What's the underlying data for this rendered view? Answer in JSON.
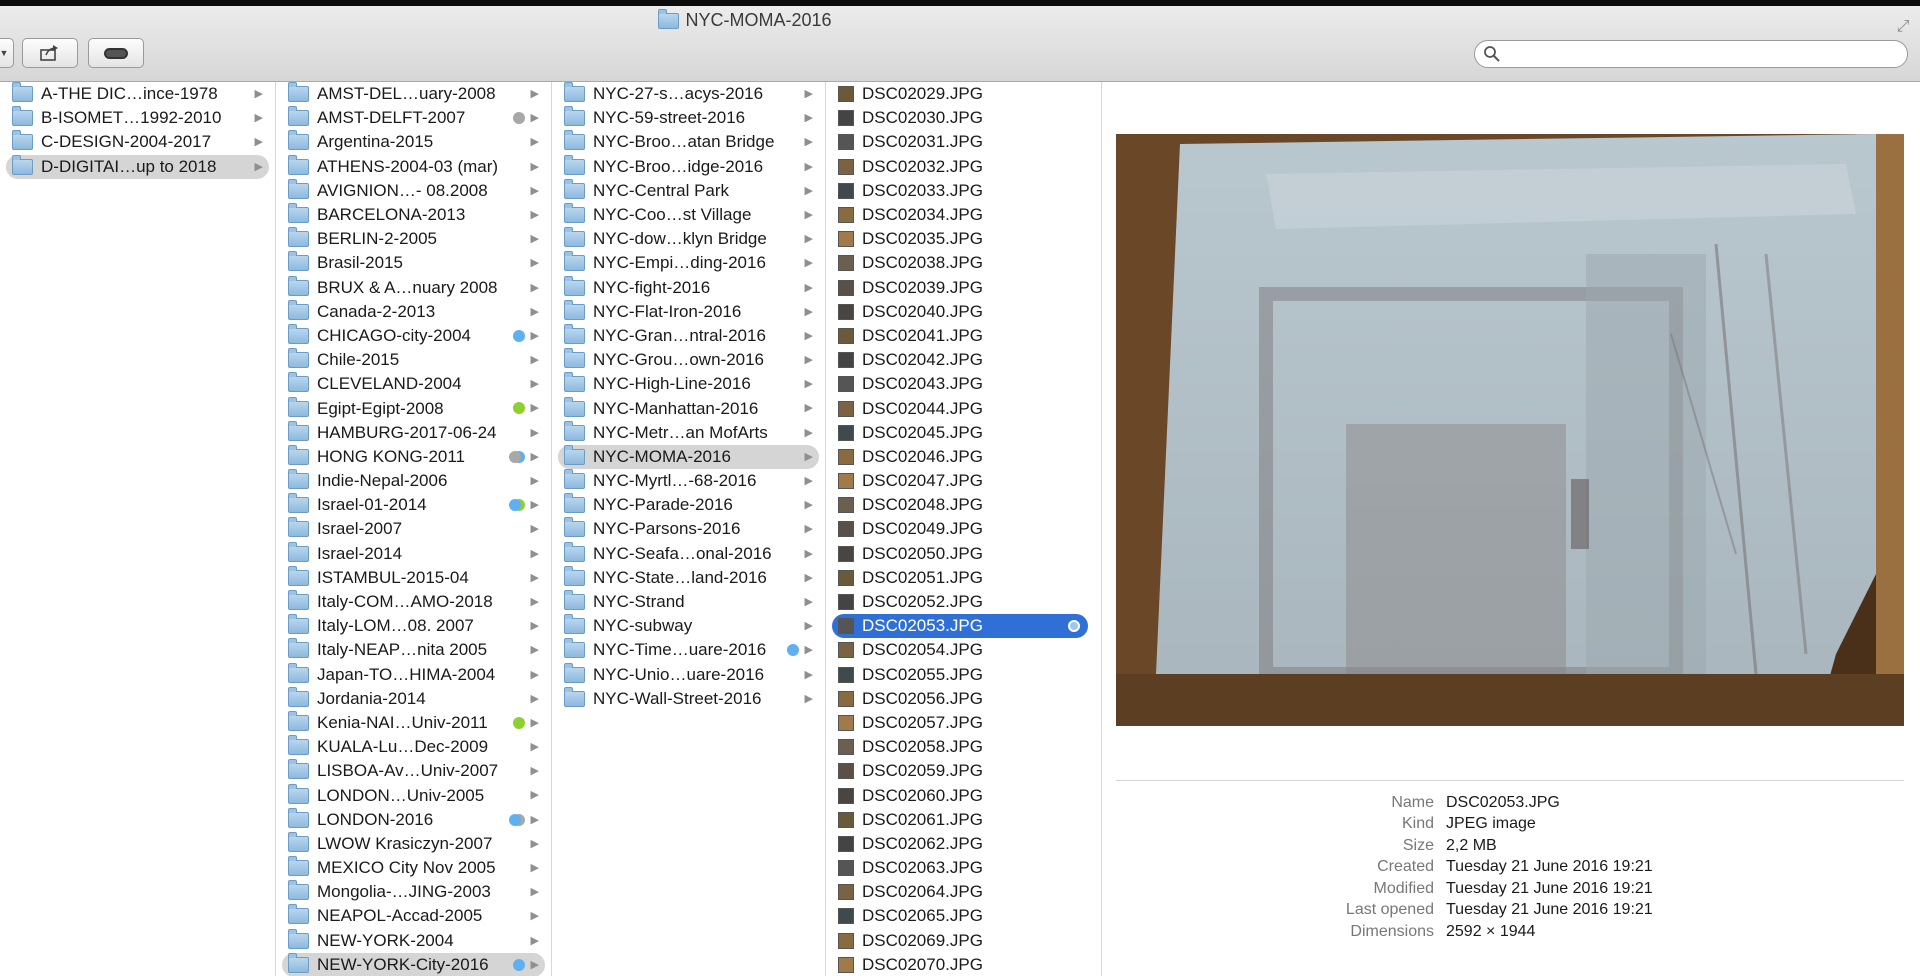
{
  "window": {
    "title": "NYC-MOMA-2016"
  },
  "search": {
    "placeholder": ""
  },
  "columns": {
    "c1": [
      {
        "label": "A-THE DIC…ince-1978"
      },
      {
        "label": "B-ISOMET…1992-2010"
      },
      {
        "label": "C-DESIGN-2004-2017"
      },
      {
        "label": "D-DIGITAI…up to 2018",
        "selected": true
      }
    ],
    "c2": [
      {
        "label": "AMST-DEL…uary-2008"
      },
      {
        "label": "AMST-DELFT-2007",
        "tags": [
          "#a8a8a8"
        ]
      },
      {
        "label": "Argentina-2015"
      },
      {
        "label": "ATHENS-2004-03 (mar)"
      },
      {
        "label": "AVIGNION…- 08.2008"
      },
      {
        "label": "BARCELONA-2013"
      },
      {
        "label": "BERLIN-2-2005"
      },
      {
        "label": "Brasil-2015"
      },
      {
        "label": "BRUX & A…nuary 2008"
      },
      {
        "label": "Canada-2-2013"
      },
      {
        "label": "CHICAGO-city-2004",
        "tags": [
          "#5fb0f0"
        ]
      },
      {
        "label": "Chile-2015"
      },
      {
        "label": "CLEVELAND-2004"
      },
      {
        "label": "Egipt-Egipt-2008",
        "tags": [
          "#8fd030"
        ]
      },
      {
        "label": "HAMBURG-2017-06-24"
      },
      {
        "label": "HONG KONG-2011",
        "tags": [
          "#5fb0f0",
          "#a8a8a8"
        ]
      },
      {
        "label": "Indie-Nepal-2006"
      },
      {
        "label": "Israel-01-2014",
        "tags": [
          "#8fd030",
          "#5fb0f0"
        ]
      },
      {
        "label": "Israel-2007"
      },
      {
        "label": "Israel-2014"
      },
      {
        "label": "ISTAMBUL-2015-04"
      },
      {
        "label": "Italy-COM…AMO-2018"
      },
      {
        "label": "Italy-LOM…08. 2007"
      },
      {
        "label": "Italy-NEAP…nita 2005"
      },
      {
        "label": "Japan-TO…HIMA-2004"
      },
      {
        "label": "Jordania-2014"
      },
      {
        "label": "Kenia-NAI…Univ-2011",
        "tags": [
          "#8fd030"
        ]
      },
      {
        "label": "KUALA-Lu…Dec-2009"
      },
      {
        "label": "LISBOA-Av…Univ-2007"
      },
      {
        "label": "LONDON…Univ-2005"
      },
      {
        "label": "LONDON-2016",
        "tags": [
          "#a8a8a8",
          "#5fb0f0"
        ]
      },
      {
        "label": "LWOW Krasiczyn-2007"
      },
      {
        "label": "MEXICO City Nov 2005"
      },
      {
        "label": "Mongolia-…JING-2003"
      },
      {
        "label": "NEAPOL-Accad-2005"
      },
      {
        "label": "NEW-YORK-2004"
      },
      {
        "label": "NEW-YORK-City-2016",
        "tags": [
          "#5fb0f0"
        ],
        "selected": true
      }
    ],
    "c3": [
      {
        "label": "NYC-27-s…acys-2016"
      },
      {
        "label": "NYC-59-street-2016"
      },
      {
        "label": "NYC-Broo…atan Bridge"
      },
      {
        "label": "NYC-Broo…idge-2016"
      },
      {
        "label": "NYC-Central Park"
      },
      {
        "label": "NYC-Coo…st Village"
      },
      {
        "label": "NYC-dow…klyn Bridge"
      },
      {
        "label": "NYC-Empi…ding-2016"
      },
      {
        "label": "NYC-fight-2016"
      },
      {
        "label": "NYC-Flat-Iron-2016"
      },
      {
        "label": "NYC-Gran…ntral-2016"
      },
      {
        "label": "NYC-Grou…own-2016"
      },
      {
        "label": "NYC-High-Line-2016"
      },
      {
        "label": "NYC-Manhattan-2016"
      },
      {
        "label": "NYC-Metr…an MofArts"
      },
      {
        "label": "NYC-MOMA-2016",
        "selected": true
      },
      {
        "label": "NYC-Myrtl…-68-2016"
      },
      {
        "label": "NYC-Parade-2016"
      },
      {
        "label": "NYC-Parsons-2016"
      },
      {
        "label": "NYC-Seafa…onal-2016"
      },
      {
        "label": "NYC-State…land-2016"
      },
      {
        "label": "NYC-Strand"
      },
      {
        "label": "NYC-subway"
      },
      {
        "label": "NYC-Time…uare-2016",
        "tags": [
          "#5fb0f0"
        ]
      },
      {
        "label": "NYC-Unio…uare-2016"
      },
      {
        "label": "NYC-Wall-Street-2016"
      }
    ],
    "c4": [
      "DSC02029.JPG",
      "DSC02030.JPG",
      "DSC02031.JPG",
      "DSC02032.JPG",
      "DSC02033.JPG",
      "DSC02034.JPG",
      "DSC02035.JPG",
      "DSC02038.JPG",
      "DSC02039.JPG",
      "DSC02040.JPG",
      "DSC02041.JPG",
      "DSC02042.JPG",
      "DSC02043.JPG",
      "DSC02044.JPG",
      "DSC02045.JPG",
      "DSC02046.JPG",
      "DSC02047.JPG",
      "DSC02048.JPG",
      "DSC02049.JPG",
      "DSC02050.JPG",
      "DSC02051.JPG",
      "DSC02052.JPG",
      "DSC02053.JPG",
      "DSC02054.JPG",
      "DSC02055.JPG",
      "DSC02056.JPG",
      "DSC02057.JPG",
      "DSC02058.JPG",
      "DSC02059.JPG",
      "DSC02060.JPG",
      "DSC02061.JPG",
      "DSC02062.JPG",
      "DSC02063.JPG",
      "DSC02064.JPG",
      "DSC02065.JPG",
      "DSC02069.JPG",
      "DSC02070.JPG"
    ],
    "c4_selected": "DSC02053.JPG"
  },
  "preview": {
    "info": [
      {
        "key": "Name",
        "value": "DSC02053.JPG"
      },
      {
        "key": "Kind",
        "value": "JPEG image"
      },
      {
        "key": "Size",
        "value": "2,2 MB"
      },
      {
        "key": "Created",
        "value": "Tuesday 21 June 2016 19:21"
      },
      {
        "key": "Modified",
        "value": "Tuesday 21 June 2016 19:21"
      },
      {
        "key": "Last opened",
        "value": "Tuesday 21 June 2016 19:21"
      },
      {
        "key": "Dimensions",
        "value": "2592 × 1944"
      }
    ]
  },
  "colors": {
    "selection_blue": "#3070d6",
    "selection_grey": "#d5d5d5",
    "folder_blue": "#8db9de"
  }
}
